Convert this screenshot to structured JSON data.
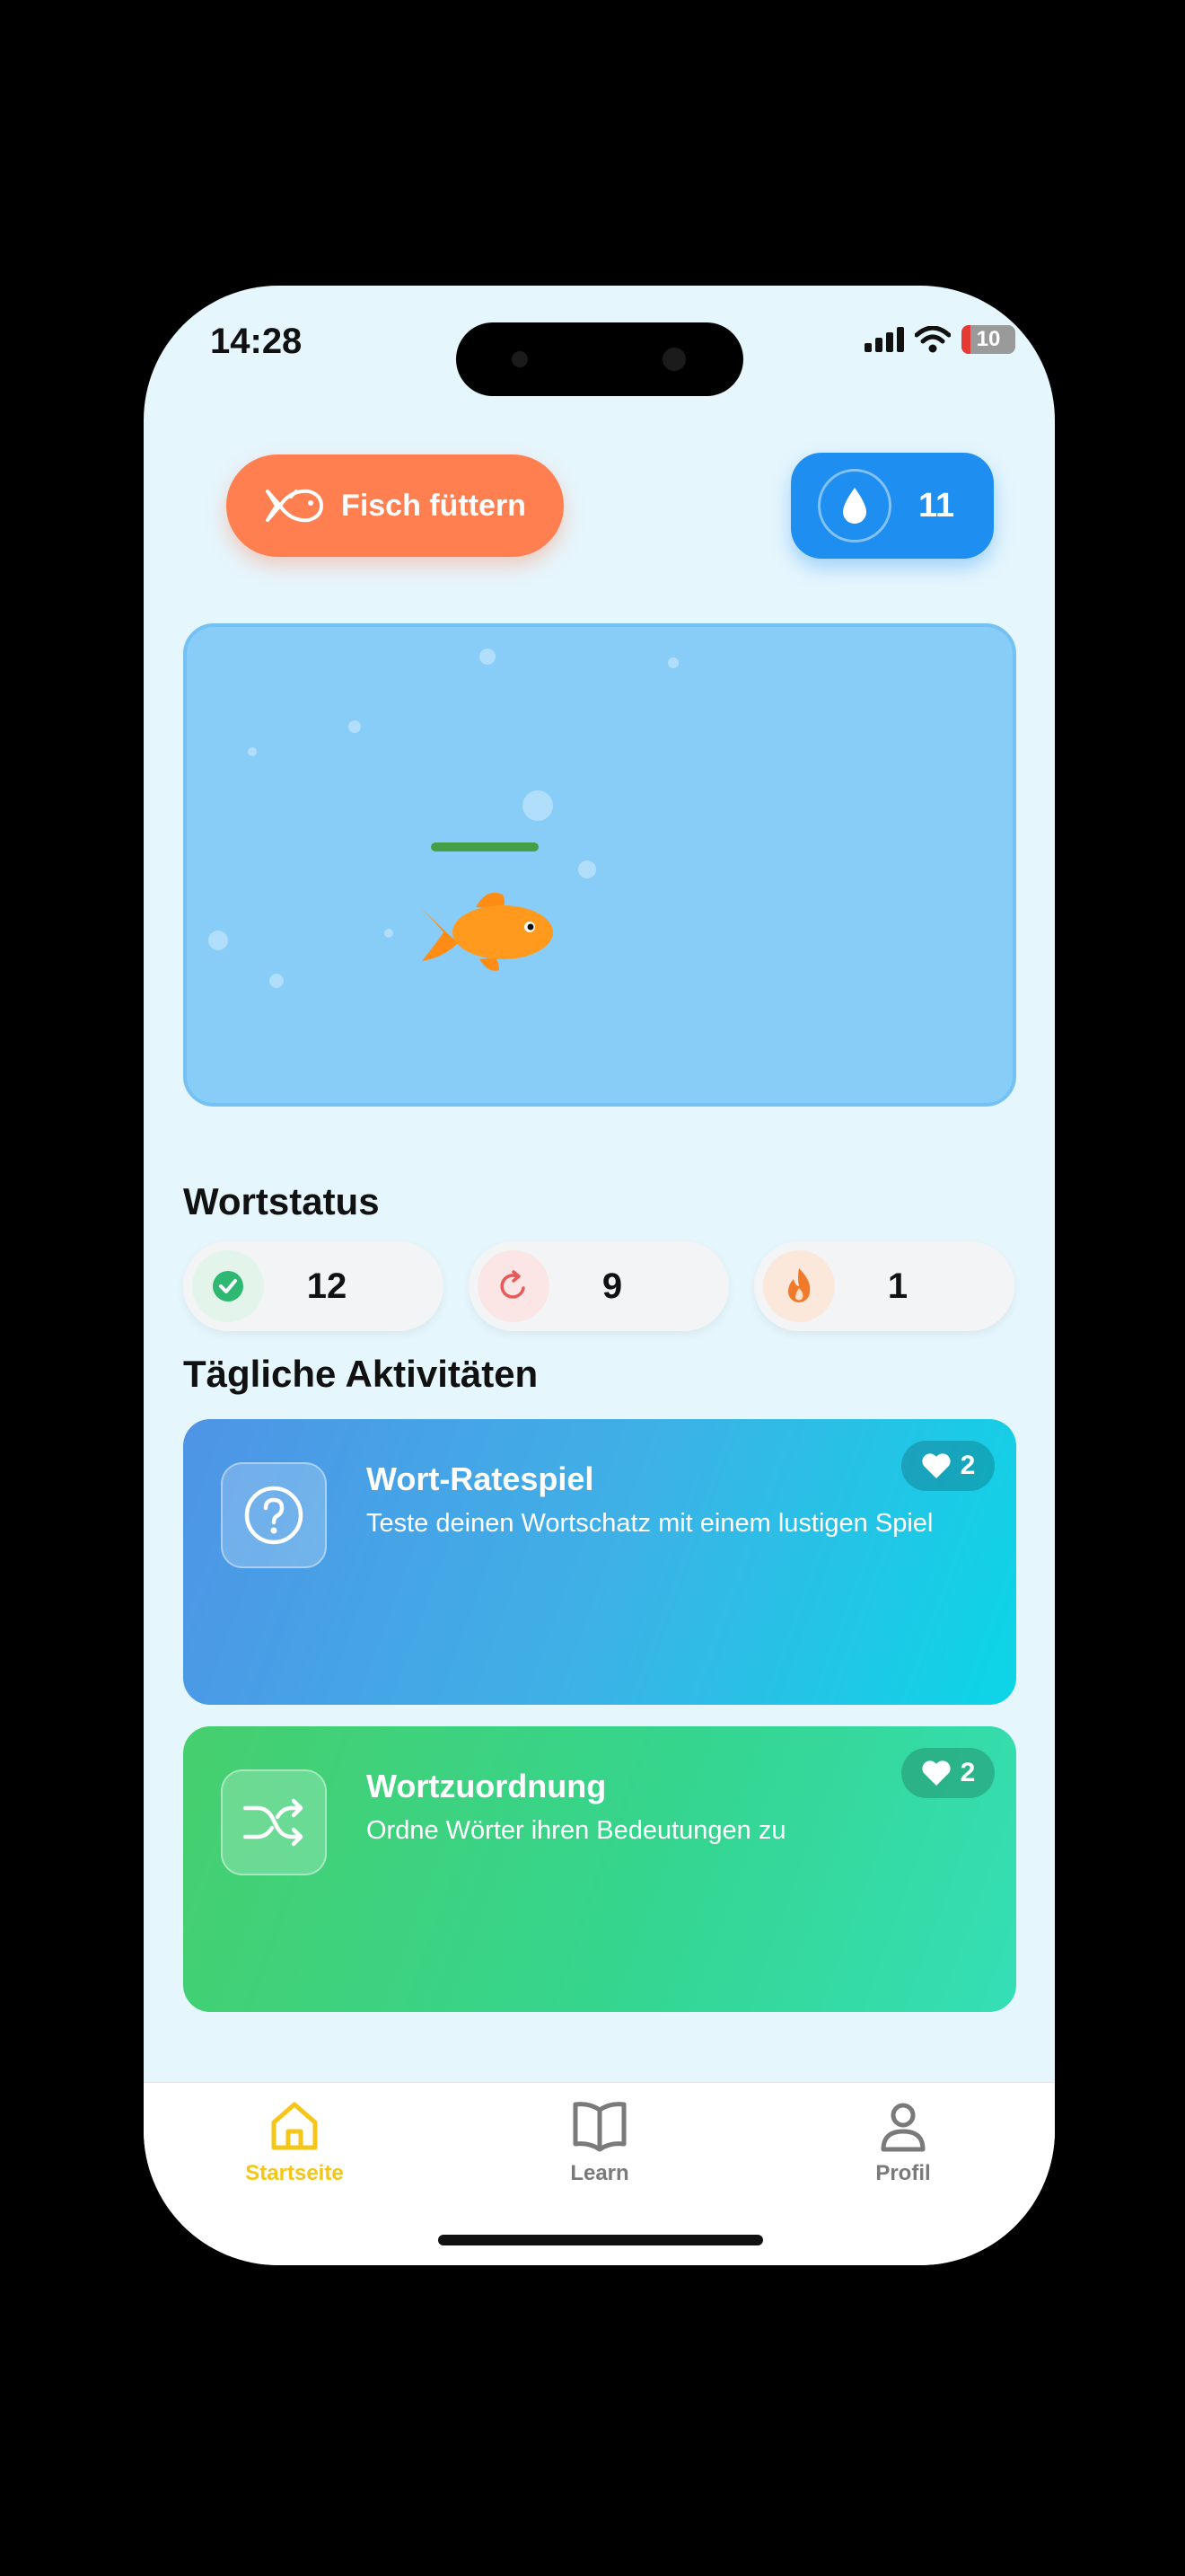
{
  "status_bar": {
    "time": "14:28",
    "battery": "10"
  },
  "header": {
    "feed_button_label": "Fisch füttern",
    "drops_count": "11"
  },
  "word_status": {
    "title": "Wortstatus",
    "items": [
      {
        "icon": "checkmark-icon",
        "value": "12",
        "color": "#2EB872"
      },
      {
        "icon": "refresh-icon",
        "value": "9",
        "color": "#E85A5A"
      },
      {
        "icon": "flame-icon",
        "value": "1",
        "color": "#F07A2A"
      }
    ]
  },
  "daily_activities": {
    "title": "Tägliche Aktivitäten",
    "cards": [
      {
        "icon": "question-icon",
        "title": "Wort-Ratespiel",
        "description": "Teste deinen Wortschatz mit einem lustigen Spiel",
        "hearts": "2"
      },
      {
        "icon": "shuffle-icon",
        "title": "Wortzuordnung",
        "description": "Ordne Wörter ihren Bedeutungen zu",
        "hearts": "2"
      }
    ]
  },
  "tabs": [
    {
      "icon": "home-icon",
      "label": "Startseite",
      "active": true
    },
    {
      "icon": "book-icon",
      "label": "Learn",
      "active": false
    },
    {
      "icon": "profile-icon",
      "label": "Profil",
      "active": false
    }
  ],
  "colors": {
    "background": "#E6F6FD",
    "feed_button": "#FF7F50",
    "drops_badge": "#1E8FF0",
    "tank": "#88CCF8",
    "tab_active": "#F5C518",
    "tab_inactive": "#7A7A7A"
  }
}
